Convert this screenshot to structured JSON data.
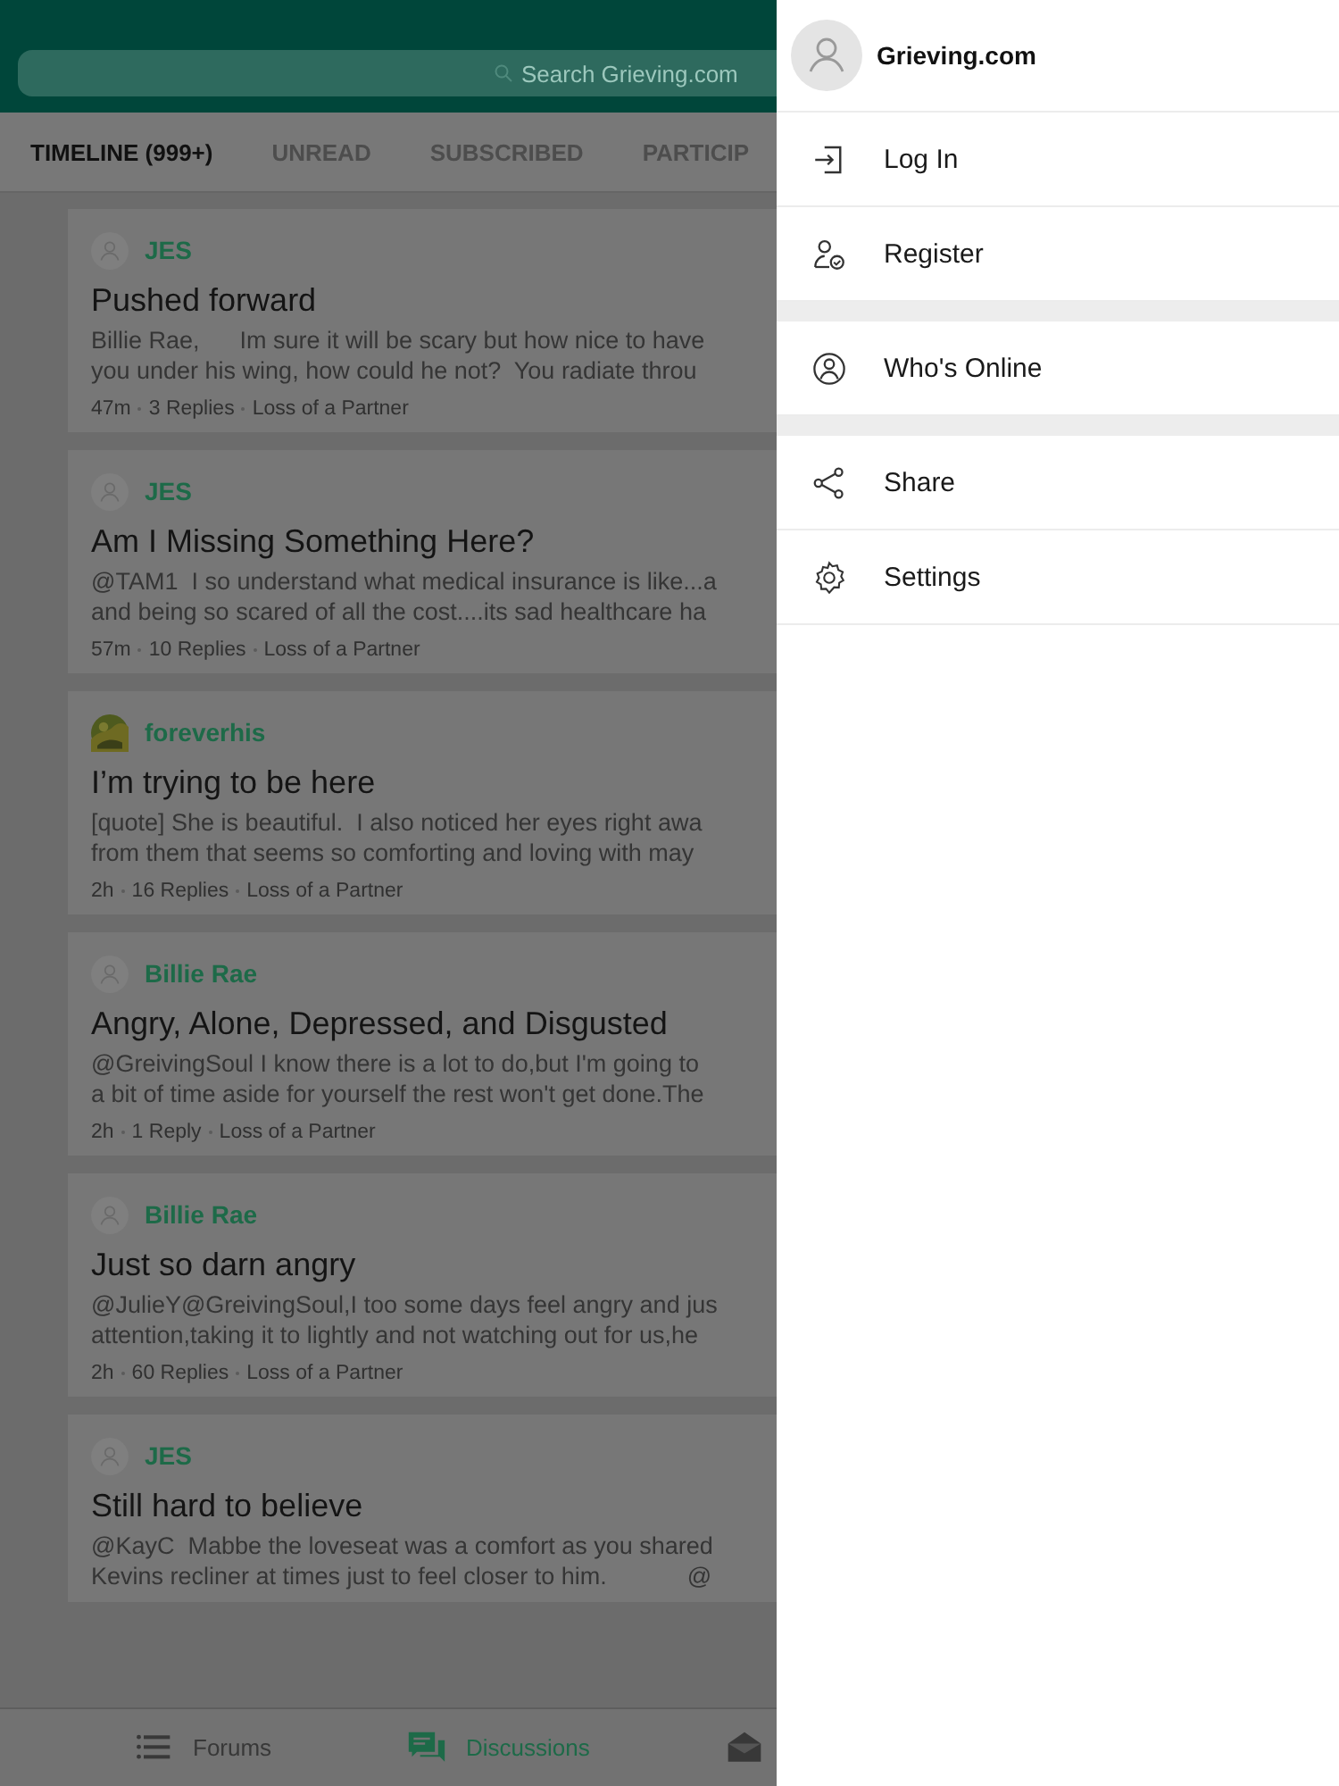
{
  "search": {
    "placeholder": "Search Grieving.com"
  },
  "tabs": [
    {
      "label": "TIMELINE (999+)",
      "selected": true
    },
    {
      "label": "UNREAD",
      "selected": false
    },
    {
      "label": "SUBSCRIBED",
      "selected": false
    },
    {
      "label": "PARTICIP",
      "selected": false
    }
  ],
  "posts": [
    {
      "user": "JES",
      "kind": "default",
      "title": "Pushed forward",
      "excerpt": [
        "Billie Rae,      Im sure it will be scary but how nice to have",
        "you under his wing, how could he not?  You radiate throu"
      ],
      "meta": [
        "47m",
        "3 Replies",
        "Loss of a Partner"
      ]
    },
    {
      "user": "JES",
      "kind": "default",
      "title": "Am I Missing Something Here?",
      "excerpt": [
        "@TAM1  I so understand what medical insurance is like...a",
        "and being so scared of all the cost....its sad healthcare ha"
      ],
      "meta": [
        "57m",
        "10 Replies",
        "Loss of a Partner"
      ]
    },
    {
      "user": "foreverhis",
      "kind": "picture",
      "title": "I’m trying to be here",
      "excerpt": [
        "[quote] She is beautiful.  I also noticed her eyes right awa",
        "from them that seems so comforting and loving with may"
      ],
      "meta": [
        "2h",
        "16 Replies",
        "Loss of a Partner"
      ]
    },
    {
      "user": "Billie Rae",
      "kind": "default",
      "title": "Angry, Alone, Depressed, and Disgusted",
      "excerpt": [
        "@GreivingSoul I know there is a lot to do,but I'm going to",
        "a bit of time aside for yourself the rest won't get done.The"
      ],
      "meta": [
        "2h",
        "1 Reply",
        "Loss of a Partner"
      ]
    },
    {
      "user": "Billie Rae",
      "kind": "default",
      "title": "Just so darn angry",
      "excerpt": [
        "@JulieY@GreivingSoul,I too some days feel angry and jus",
        "attention,taking it to lightly and not watching out for us,he"
      ],
      "meta": [
        "2h",
        "60 Replies",
        "Loss of a Partner"
      ]
    },
    {
      "user": "JES",
      "kind": "default",
      "title": "Still hard to believe",
      "excerpt": [
        "@KayC  Mabbe the loveseat was a comfort as you shared",
        "Kevins recliner at times just to feel closer to him.            @"
      ]
    }
  ],
  "bottom_nav": [
    {
      "label": "Forums",
      "selected": false
    },
    {
      "label": "Discussions",
      "selected": true
    },
    {
      "selected": false
    }
  ],
  "drawer": {
    "title": "Grieving.com",
    "groups": [
      [
        {
          "label": "Log In"
        },
        {
          "label": "Register"
        }
      ],
      [
        {
          "label": "Who's Online"
        }
      ],
      [
        {
          "label": "Share"
        },
        {
          "label": "Settings"
        }
      ]
    ]
  }
}
